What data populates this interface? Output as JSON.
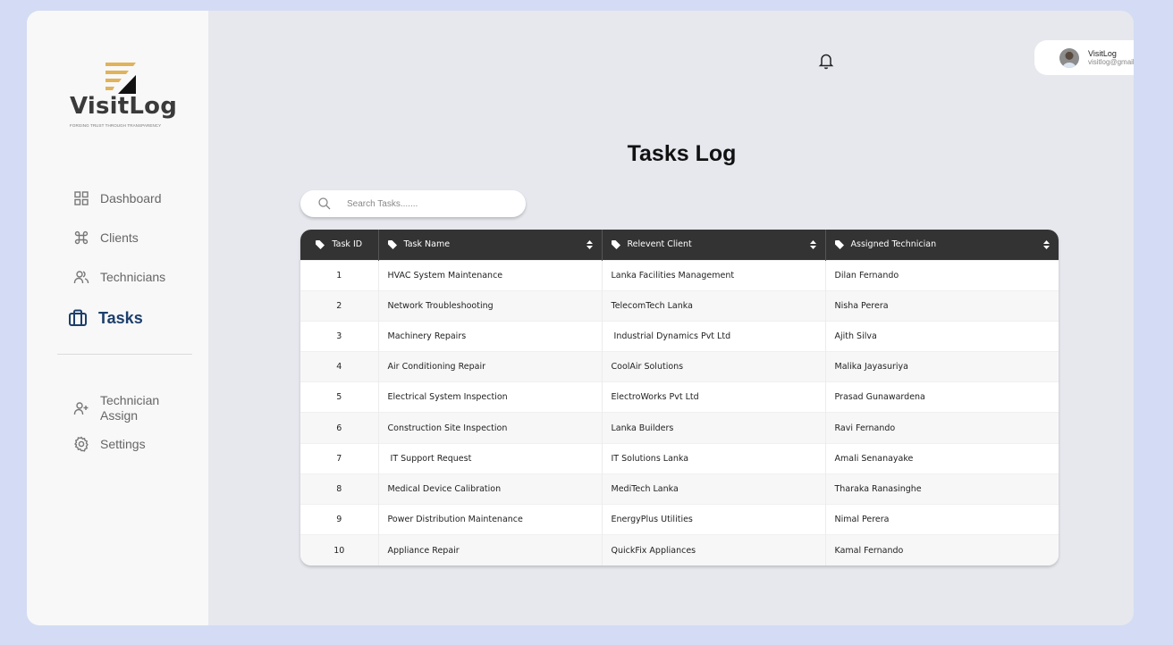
{
  "brand": {
    "name": "VisitLog",
    "tagline": "FORGING TRUST THROUGH TRANSPARENCY",
    "colors": {
      "gold": "#e0b35a",
      "dark": "#111111",
      "accent": "#1c3f6b"
    }
  },
  "sidebar": {
    "items": [
      {
        "label": "Dashboard",
        "icon": "grid-icon",
        "active": false
      },
      {
        "label": "Clients",
        "icon": "command-icon",
        "active": false
      },
      {
        "label": "Technicians",
        "icon": "users-icon",
        "active": false
      },
      {
        "label": "Tasks",
        "icon": "briefcase-icon",
        "active": true
      }
    ],
    "secondary": [
      {
        "label_line1": "Technician",
        "label_line2": "Assign",
        "icon": "user-plus-icon"
      },
      {
        "label": "Settings",
        "icon": "gear-icon"
      }
    ]
  },
  "header": {
    "notification_icon": "bell-icon",
    "user": {
      "name": "VisitLog",
      "email": "visitlog@gmail.com"
    }
  },
  "main": {
    "title": "Tasks Log",
    "search": {
      "placeholder": "Search Tasks.......",
      "value": ""
    },
    "table": {
      "columns": [
        {
          "label": "Task ID",
          "sortable": false
        },
        {
          "label": "Task Name",
          "sortable": true
        },
        {
          "label": "Relevent Client",
          "sortable": true
        },
        {
          "label": "Assigned Technician",
          "sortable": true
        }
      ],
      "rows": [
        {
          "id": "1",
          "task": "HVAC System Maintenance",
          "client": "Lanka Facilities Management",
          "technician": "Dilan Fernando"
        },
        {
          "id": "2",
          "task": "Network Troubleshooting",
          "client": "TelecomTech Lanka",
          "technician": "Nisha Perera"
        },
        {
          "id": "3",
          "task": "Machinery Repairs",
          "client": " Industrial Dynamics Pvt Ltd",
          "technician": "Ajith Silva"
        },
        {
          "id": "4",
          "task": "Air Conditioning Repair",
          "client": "CoolAir Solutions",
          "technician": "Malika Jayasuriya"
        },
        {
          "id": "5",
          "task": "Electrical System Inspection",
          "client": "ElectroWorks Pvt Ltd",
          "technician": "Prasad Gunawardena"
        },
        {
          "id": "6",
          "task": "Construction Site Inspection",
          "client": "Lanka Builders",
          "technician": "Ravi Fernando"
        },
        {
          "id": "7",
          "task": " IT Support Request",
          "client": "IT Solutions Lanka",
          "technician": "Amali Senanayake"
        },
        {
          "id": "8",
          "task": "Medical Device Calibration",
          "client": "MediTech Lanka",
          "technician": "Tharaka Ranasinghe"
        },
        {
          "id": "9",
          "task": "Power Distribution Maintenance",
          "client": "EnergyPlus Utilities",
          "technician": "Nimal Perera"
        },
        {
          "id": "10",
          "task": "Appliance Repair",
          "client": "QuickFix Appliances",
          "technician": "Kamal Fernando"
        }
      ]
    }
  }
}
